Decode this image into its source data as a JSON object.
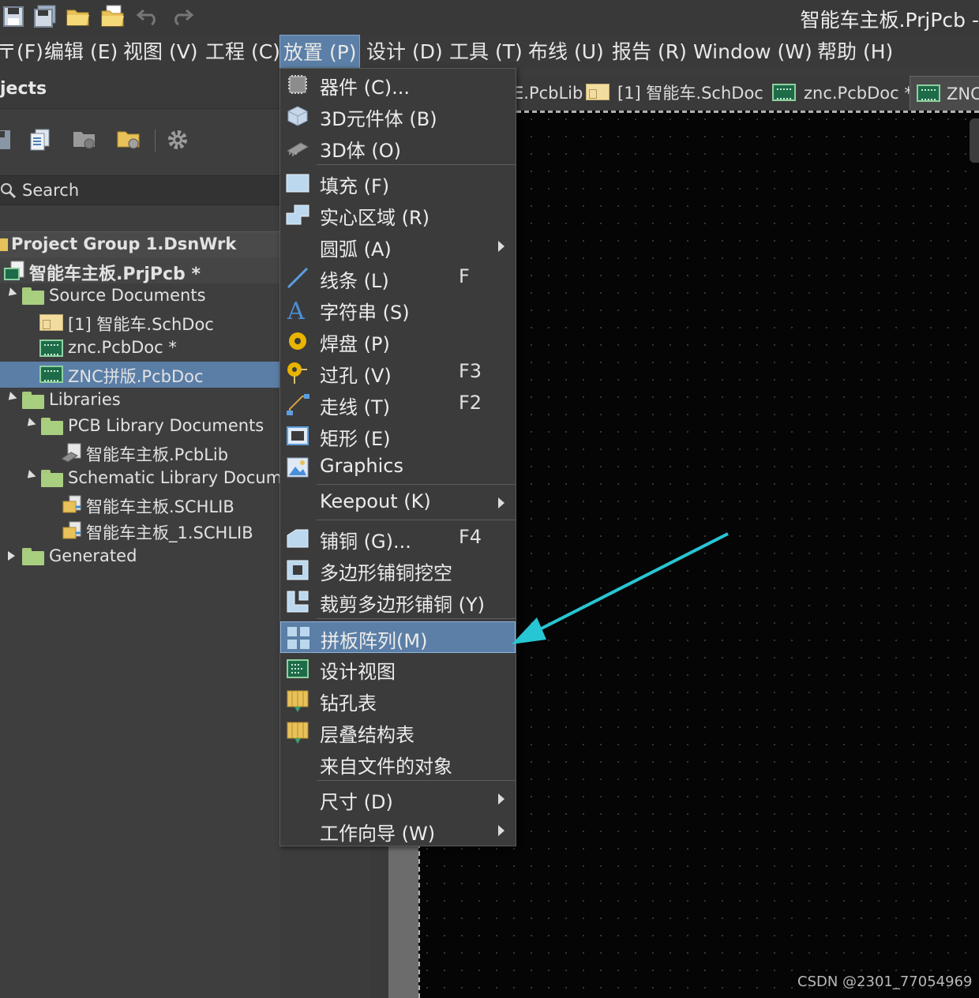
{
  "window": {
    "title": "智能车主板.PrjPcb -"
  },
  "menubar": {
    "items": [
      {
        "label": "(F)",
        "prefix": "件 "
      },
      {
        "label": "编辑 (E)"
      },
      {
        "label": "视图 (V)"
      },
      {
        "label": "工程 (C)"
      },
      {
        "label": "放置 (P)"
      },
      {
        "label": "设计 (D)"
      },
      {
        "label": "工具 (T)"
      },
      {
        "label": "布线 (U)"
      },
      {
        "label": "报告 (R)"
      },
      {
        "label": "Window (W)"
      },
      {
        "label": "帮助 (H)"
      }
    ]
  },
  "panel": {
    "title": "jects",
    "search_placeholder": "Search",
    "tree": [
      {
        "label": "Project Group 1.DsnWrk"
      },
      {
        "label": "智能车主板.PrjPcb *"
      },
      {
        "label": "Source Documents"
      },
      {
        "label": "[1] 智能车.SchDoc"
      },
      {
        "label": "znc.PcbDoc *"
      },
      {
        "label": "ZNC拼版.PcbDoc"
      },
      {
        "label": "Libraries"
      },
      {
        "label": "PCB Library Documents"
      },
      {
        "label": "智能车主板.PcbLib"
      },
      {
        "label": "Schematic Library Documen"
      },
      {
        "label": "智能车主板.SCHLIB"
      },
      {
        "label": "智能车主板_1.SCHLIB"
      },
      {
        "label": "Generated"
      }
    ]
  },
  "tabs": [
    {
      "label": "E.PcbLib"
    },
    {
      "label": "[1] 智能车.SchDoc"
    },
    {
      "label": "znc.PcbDoc *"
    },
    {
      "label": "ZNC"
    }
  ],
  "place_menu": {
    "items": [
      {
        "label": "器件 (C)...",
        "key": ""
      },
      {
        "label": "3D元件体 (B)",
        "key": ""
      },
      {
        "label": "3D体 (O)",
        "key": ""
      },
      {
        "label": "填充 (F)",
        "key": ""
      },
      {
        "label": "实心区域 (R)",
        "key": ""
      },
      {
        "label": "圆弧 (A)",
        "key": ""
      },
      {
        "label": "线条 (L)",
        "key": "F"
      },
      {
        "label": "字符串 (S)",
        "key": ""
      },
      {
        "label": "焊盘 (P)",
        "key": ""
      },
      {
        "label": "过孔 (V)",
        "key": "F3"
      },
      {
        "label": "走线 (T)",
        "key": "F2"
      },
      {
        "label": "矩形 (E)",
        "key": ""
      },
      {
        "label": "Graphics",
        "key": ""
      },
      {
        "label": "Keepout (K)",
        "key": ""
      },
      {
        "label": "铺铜 (G)...",
        "key": "F4"
      },
      {
        "label": "多边形铺铜挖空",
        "key": ""
      },
      {
        "label": "裁剪多边形铺铜 (Y)",
        "key": ""
      },
      {
        "label": "拼板阵列(M)",
        "key": ""
      },
      {
        "label": "设计视图",
        "key": ""
      },
      {
        "label": "钻孔表",
        "key": ""
      },
      {
        "label": "层叠结构表",
        "key": ""
      },
      {
        "label": "来自文件的对象",
        "key": ""
      },
      {
        "label": "尺寸 (D)",
        "key": ""
      },
      {
        "label": "工作向导 (W)",
        "key": ""
      }
    ]
  },
  "watermark": "CSDN @2301_77054969",
  "colors": {
    "highlight": "#5b7fa6",
    "arrow": "#27c6d4",
    "canvas": "#050505"
  }
}
